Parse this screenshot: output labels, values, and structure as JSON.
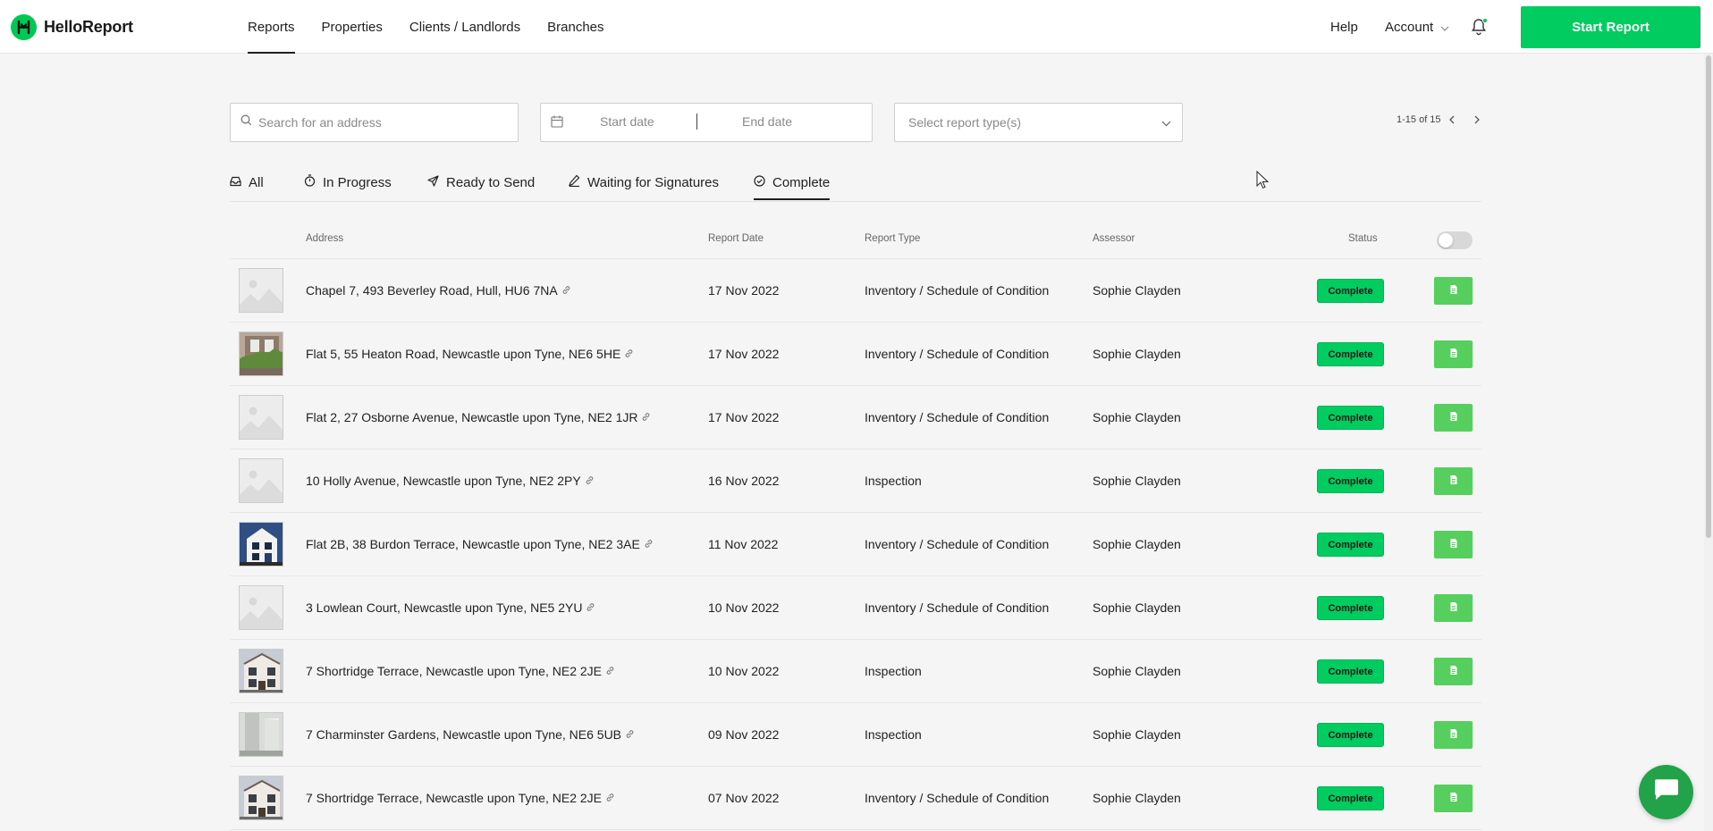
{
  "app": {
    "logo_text": "HelloReport",
    "brand_color": "#00cc5f"
  },
  "nav": {
    "items": [
      "Reports",
      "Properties",
      "Clients / Landlords",
      "Branches"
    ],
    "active": "Reports"
  },
  "header": {
    "help": "Help",
    "account": "Account",
    "start_report": "Start Report"
  },
  "filters": {
    "search_placeholder": "Search for an address",
    "start_date_placeholder": "Start date",
    "end_date_placeholder": "End date",
    "report_type_placeholder": "Select report type(s)"
  },
  "pagination": {
    "label": "1-15 of 15"
  },
  "tabs": {
    "items": [
      {
        "label": "All",
        "icon": "inbox-icon"
      },
      {
        "label": "In Progress",
        "icon": "timer-icon"
      },
      {
        "label": "Ready to Send",
        "icon": "send-icon"
      },
      {
        "label": "Waiting for Signatures",
        "icon": "pen-icon"
      },
      {
        "label": "Complete",
        "icon": "check-circle-icon"
      }
    ],
    "active": "Complete"
  },
  "table": {
    "columns": [
      "Address",
      "Report Date",
      "Report Type",
      "Assessor",
      "Status"
    ],
    "toggle_on": false,
    "rows": [
      {
        "address": "Chapel 7, 493 Beverley Road, Hull, HU6 7NA",
        "date": "17 Nov 2022",
        "type": "Inventory / Schedule of Condition",
        "assessor": "Sophie Clayden",
        "status": "Complete",
        "thumb": "placeholder"
      },
      {
        "address": "Flat 5, 55 Heaton Road, Newcastle upon Tyne, NE6 5HE",
        "date": "17 Nov 2022",
        "type": "Inventory / Schedule of Condition",
        "assessor": "Sophie Clayden",
        "status": "Complete",
        "thumb": "photo-garden"
      },
      {
        "address": "Flat 2, 27 Osborne Avenue, Newcastle upon Tyne, NE2 1JR",
        "date": "17 Nov 2022",
        "type": "Inventory / Schedule of Condition",
        "assessor": "Sophie Clayden",
        "status": "Complete",
        "thumb": "placeholder"
      },
      {
        "address": "10 Holly Avenue, Newcastle upon Tyne, NE2 2PY",
        "date": "16 Nov 2022",
        "type": "Inspection",
        "assessor": "Sophie Clayden",
        "status": "Complete",
        "thumb": "placeholder"
      },
      {
        "address": "Flat 2B, 38 Burdon Terrace, Newcastle upon Tyne, NE2 3AE",
        "date": "11 Nov 2022",
        "type": "Inventory / Schedule of Condition",
        "assessor": "Sophie Clayden",
        "status": "Complete",
        "thumb": "photo-house-blue"
      },
      {
        "address": "3 Lowlean Court, Newcastle upon Tyne, NE5 2YU",
        "date": "10 Nov 2022",
        "type": "Inventory / Schedule of Condition",
        "assessor": "Sophie Clayden",
        "status": "Complete",
        "thumb": "placeholder"
      },
      {
        "address": "7 Shortridge Terrace, Newcastle upon Tyne, NE2 2JE",
        "date": "10 Nov 2022",
        "type": "Inspection",
        "assessor": "Sophie Clayden",
        "status": "Complete",
        "thumb": "photo-house"
      },
      {
        "address": "7 Charminster Gardens, Newcastle upon Tyne, NE6 5UB",
        "date": "09 Nov 2022",
        "type": "Inspection",
        "assessor": "Sophie Clayden",
        "status": "Complete",
        "thumb": "photo-interior"
      },
      {
        "address": "7 Shortridge Terrace, Newcastle upon Tyne, NE2 2JE",
        "date": "07 Nov 2022",
        "type": "Inventory / Schedule of Condition",
        "assessor": "Sophie Clayden",
        "status": "Complete",
        "thumb": "photo-house"
      }
    ]
  }
}
